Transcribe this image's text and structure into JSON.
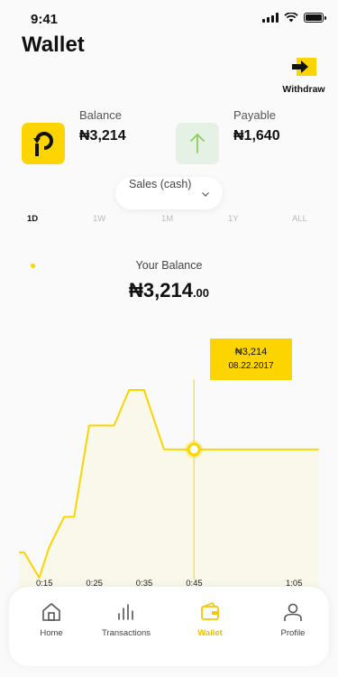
{
  "status_bar": {
    "time": "9:41"
  },
  "header": {
    "title": "Wallet"
  },
  "withdraw": {
    "label": "Withdraw",
    "icon": "withdraw-arrow-icon"
  },
  "summary": {
    "balance": {
      "label": "Balance",
      "amount": "₦3,214",
      "icon": "refresh-coin-icon",
      "tile_color": "#fcd500"
    },
    "payable": {
      "label": "Payable",
      "amount": "₦1,640",
      "icon": "arrow-up-icon",
      "tile_color": "#e6f1e6"
    }
  },
  "sales_select": {
    "value": "Sales (cash)"
  },
  "periods": [
    "1D",
    "1W",
    "1M",
    "1Y",
    "ALL"
  ],
  "active_period": "1D",
  "your_balance": {
    "label": "Your Balance",
    "amount": "₦3,214",
    "cents": ".00"
  },
  "tooltip": {
    "value": "₦3,214",
    "date": "08.22.2017"
  },
  "accent_color": "#fcd500",
  "chart_data": {
    "type": "line",
    "title": "",
    "xlabel": "",
    "ylabel": "",
    "x_ticks": [
      "0:15",
      "0:25",
      "0:35",
      "0:45",
      "1:05"
    ],
    "series": [
      {
        "values": [
          {
            "x": "0:10",
            "y": 2200
          },
          {
            "x": "0:11",
            "y": 2200
          },
          {
            "x": "0:14",
            "y": 1950
          },
          {
            "x": "0:16",
            "y": 2250
          },
          {
            "x": "0:19",
            "y": 2550
          },
          {
            "x": "0:21",
            "y": 2550
          },
          {
            "x": "0:24",
            "y": 3450
          },
          {
            "x": "0:29",
            "y": 3450
          },
          {
            "x": "0:32",
            "y": 3800
          },
          {
            "x": "0:35",
            "y": 3800
          },
          {
            "x": "0:39",
            "y": 3214
          },
          {
            "x": "0:45",
            "y": 3214
          },
          {
            "x": "1:05",
            "y": 3214
          },
          {
            "x": "1:10",
            "y": 3214
          }
        ]
      }
    ],
    "highlight": {
      "x": "0:45",
      "y": 3214,
      "label": "₦3,214",
      "date": "08.22.2017"
    },
    "grid": false,
    "legend": "none"
  },
  "tab_bar": {
    "items": [
      {
        "label": "Home",
        "icon": "home-icon"
      },
      {
        "label": "Transactions",
        "icon": "bar-chart-icon"
      },
      {
        "label": "Wallet",
        "icon": "wallet-icon"
      },
      {
        "label": "Profile",
        "icon": "user-icon"
      }
    ],
    "active": "Wallet"
  }
}
